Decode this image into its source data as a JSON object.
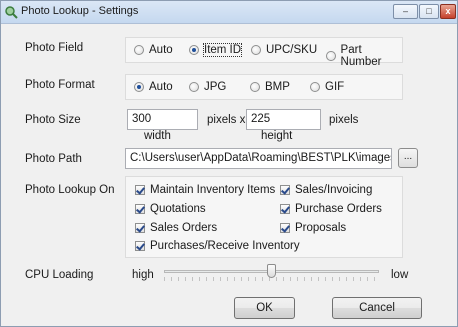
{
  "window": {
    "title": "Photo Lookup - Settings",
    "controls": {
      "minimize": "–",
      "maximize": "□",
      "close": "x"
    }
  },
  "photo_field": {
    "label": "Photo Field",
    "options": [
      {
        "label": "Auto",
        "selected": false
      },
      {
        "label": "Item ID",
        "selected": true
      },
      {
        "label": "UPC/SKU",
        "selected": false
      },
      {
        "label": "Part Number",
        "selected": false
      }
    ]
  },
  "photo_format": {
    "label": "Photo Format",
    "options": [
      {
        "label": "Auto",
        "selected": true
      },
      {
        "label": "JPG",
        "selected": false
      },
      {
        "label": "BMP",
        "selected": false
      },
      {
        "label": "GIF",
        "selected": false
      }
    ]
  },
  "photo_size": {
    "label": "Photo Size",
    "width_value": "300",
    "width_unit": "pixels x",
    "height_value": "225",
    "height_unit": "pixels",
    "width_caption": "width",
    "height_caption": "height"
  },
  "photo_path": {
    "label": "Photo Path",
    "value": "C:\\Users\\user\\AppData\\Roaming\\BEST\\PLK\\images\\",
    "browse_label": "..."
  },
  "lookup_on": {
    "label": "Photo Lookup On",
    "items": [
      {
        "label": "Maintain Inventory Items",
        "checked": true
      },
      {
        "label": "Sales/Invoicing",
        "checked": true
      },
      {
        "label": "Quotations",
        "checked": true
      },
      {
        "label": "Purchase Orders",
        "checked": true
      },
      {
        "label": "Sales Orders",
        "checked": true
      },
      {
        "label": "Proposals",
        "checked": true
      },
      {
        "label": "Purchases/Receive Inventory",
        "checked": true
      }
    ]
  },
  "cpu_loading": {
    "label": "CPU Loading",
    "low_end": "high",
    "high_end": "low",
    "level": 0.5
  },
  "buttons": {
    "ok": "OK",
    "cancel": "Cancel"
  },
  "colors": {
    "accent": "#1f4f9a",
    "window_bg": "#f0f0f0",
    "titlebar": "#c5d8ef"
  },
  "icons": {
    "app": "photo-lookup-icon"
  }
}
